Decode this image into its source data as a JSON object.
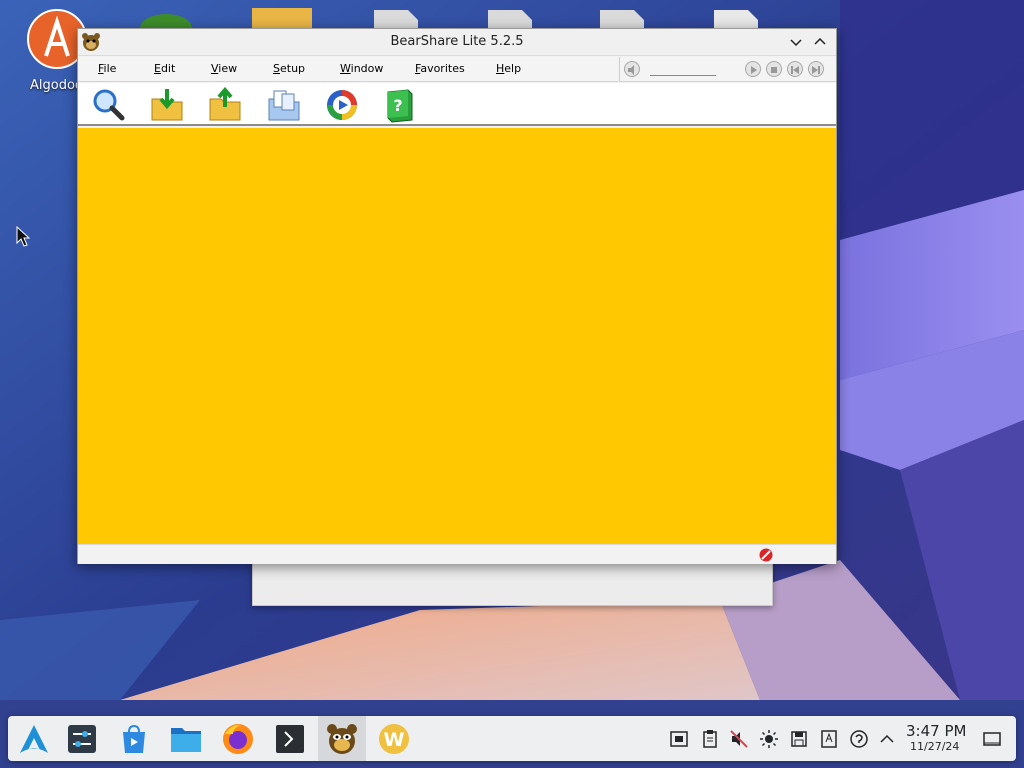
{
  "desktop": {
    "icons": [
      {
        "label": "Algodoo",
        "icon": "algodoo-icon"
      }
    ]
  },
  "window": {
    "title": "BearShare Lite 5.2.5",
    "menu": [
      {
        "label": "File",
        "mnemonic": "F",
        "rest": "ile"
      },
      {
        "label": "Edit",
        "mnemonic": "E",
        "rest": "dit"
      },
      {
        "label": "View",
        "mnemonic": "V",
        "rest": "iew"
      },
      {
        "label": "Setup",
        "mnemonic": "S",
        "rest": "etup"
      },
      {
        "label": "Window",
        "mnemonic": "W",
        "rest": "indow"
      },
      {
        "label": "Favorites",
        "mnemonic": "F",
        "rest": "avorites"
      },
      {
        "label": "Help",
        "mnemonic": "H",
        "rest": "elp"
      }
    ],
    "toolbar": [
      {
        "icon": "search-icon"
      },
      {
        "icon": "download-folder-icon"
      },
      {
        "icon": "upload-folder-icon"
      },
      {
        "icon": "library-icon"
      },
      {
        "icon": "media-player-icon"
      },
      {
        "icon": "help-book-icon"
      }
    ],
    "content_color": "#ffc800"
  },
  "taskbar": {
    "time": "3:47 PM",
    "date": "11/27/24",
    "apps": [
      {
        "icon": "app-launcher-icon"
      },
      {
        "icon": "system-settings-icon"
      },
      {
        "icon": "discover-store-icon"
      },
      {
        "icon": "file-manager-icon"
      },
      {
        "icon": "firefox-icon"
      },
      {
        "icon": "terminal-icon"
      },
      {
        "icon": "bearshare-icon",
        "active": true
      },
      {
        "icon": "wps-writer-icon"
      }
    ],
    "tray": [
      {
        "icon": "vault-icon"
      },
      {
        "icon": "clipboard-icon"
      },
      {
        "icon": "volume-muted-icon"
      },
      {
        "icon": "brightness-icon"
      },
      {
        "icon": "disk-icon"
      },
      {
        "icon": "notes-icon"
      },
      {
        "icon": "network-icon"
      },
      {
        "icon": "show-hidden-icon"
      },
      {
        "icon": "show-desktop-icon"
      }
    ]
  }
}
